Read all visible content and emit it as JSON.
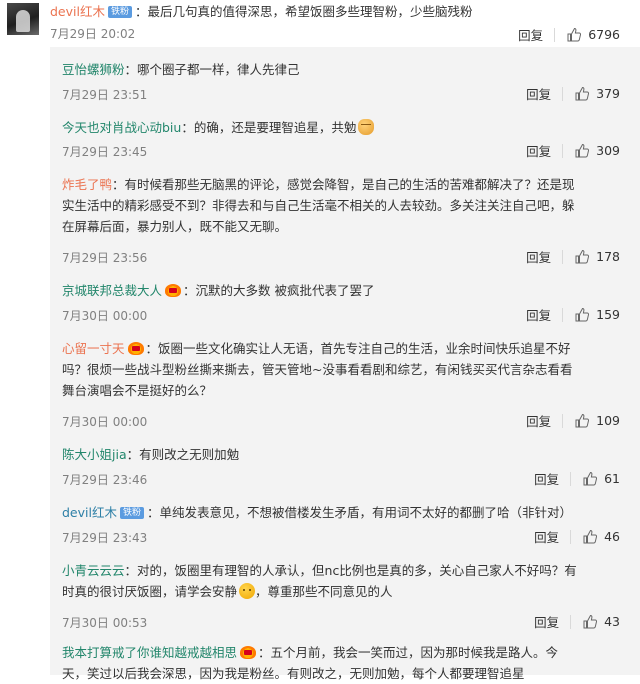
{
  "main_comment": {
    "username": "devil红木",
    "badge": "铁粉",
    "text": "：最后几句真的值得深思，希望饭圈多些理智粉，少些脑残粉",
    "time": "7月29日 20:02",
    "reply_label": "回复",
    "likes": "6796"
  },
  "replies": [
    {
      "username": "豆怡螺狮粉",
      "text": "：哪个圈子都一样，律人先律己",
      "time": "7月29日 23:51",
      "reply_label": "回复",
      "likes": "379"
    },
    {
      "username": "今天也对肖战心动biu",
      "text": "：的确，还是要理智追星，共勉",
      "emoji": "fist-emoji",
      "time": "7月29日 23:45",
      "reply_label": "回复",
      "likes": "309"
    },
    {
      "username": "炸毛了鸭",
      "text_lines": [
        "：有时候看那些无脑黑的评论，感觉会降智，是自己的生活的苦难都解决了？还是现",
        "实生活中的精彩感受不到？非得去和与自己生活毫不相关的人去较劲。多关注关注自己吧，躲",
        "在屏幕后面，暴力别人，既不能又无聊。"
      ],
      "time": "7月29日 23:56",
      "reply_label": "回复",
      "likes": "178"
    },
    {
      "username": "京城联邦总裁大人",
      "badge_icon": "vip-crown-icon",
      "text": "：沉默的大多数 被疯批代表了罢了",
      "time": "7月30日 00:00",
      "reply_label": "回复",
      "likes": "159"
    },
    {
      "username": "心留一寸天",
      "badge_icon": "vip-crown-icon",
      "text_lines": [
        "：饭圈一些文化确实让人无语，首先专注自己的生活，业余时间快乐追星不好",
        "吗？很烦一些战斗型粉丝撕来撕去，管天管地~没事看看剧和综艺，有闲钱买买代言杂志看看",
        "舞台演唱会不是挺好的么？"
      ],
      "time": "7月30日 00:00",
      "reply_label": "回复",
      "likes": "109"
    },
    {
      "username": "陈大小姐jia",
      "text": "：有则改之无则加勉",
      "time": "7月29日 23:46",
      "reply_label": "回复",
      "likes": "61"
    },
    {
      "username": "devil红木",
      "badge": "铁粉",
      "text": "：单纯发表意见，不想被借楼发生矛盾，有用词不太好的都删了哈（非针对）",
      "time": "7月29日 23:43",
      "reply_label": "回复",
      "likes": "46"
    },
    {
      "username": "小青云云云",
      "text_lines": [
        "：对的，饭圈里有理智的人承认，但nc比例也是真的多，关心自己家人不好吗？有",
        "时真的很讨厌饭圈，请学会安静",
        "，尊重那些不同意见的人"
      ],
      "emoji": "smile-emoji",
      "time": "7月30日 00:53",
      "reply_label": "回复",
      "likes": "43"
    },
    {
      "username": "我本打算戒了你谁知越戒越相思",
      "badge_icon": "vip-crown-icon",
      "text_lines": [
        "：五个月前，我会一笑而过，因为那时候我是路人。今",
        "天，笑过以后我会深思，因为我是粉丝。有则改之，无则加勉，每个人都要理智追星"
      ]
    }
  ],
  "colors": {
    "username": "#eb7350",
    "panel_bg": "#f3f3f3",
    "meta": "#808080",
    "fan_badge": "#5b9be0"
  }
}
